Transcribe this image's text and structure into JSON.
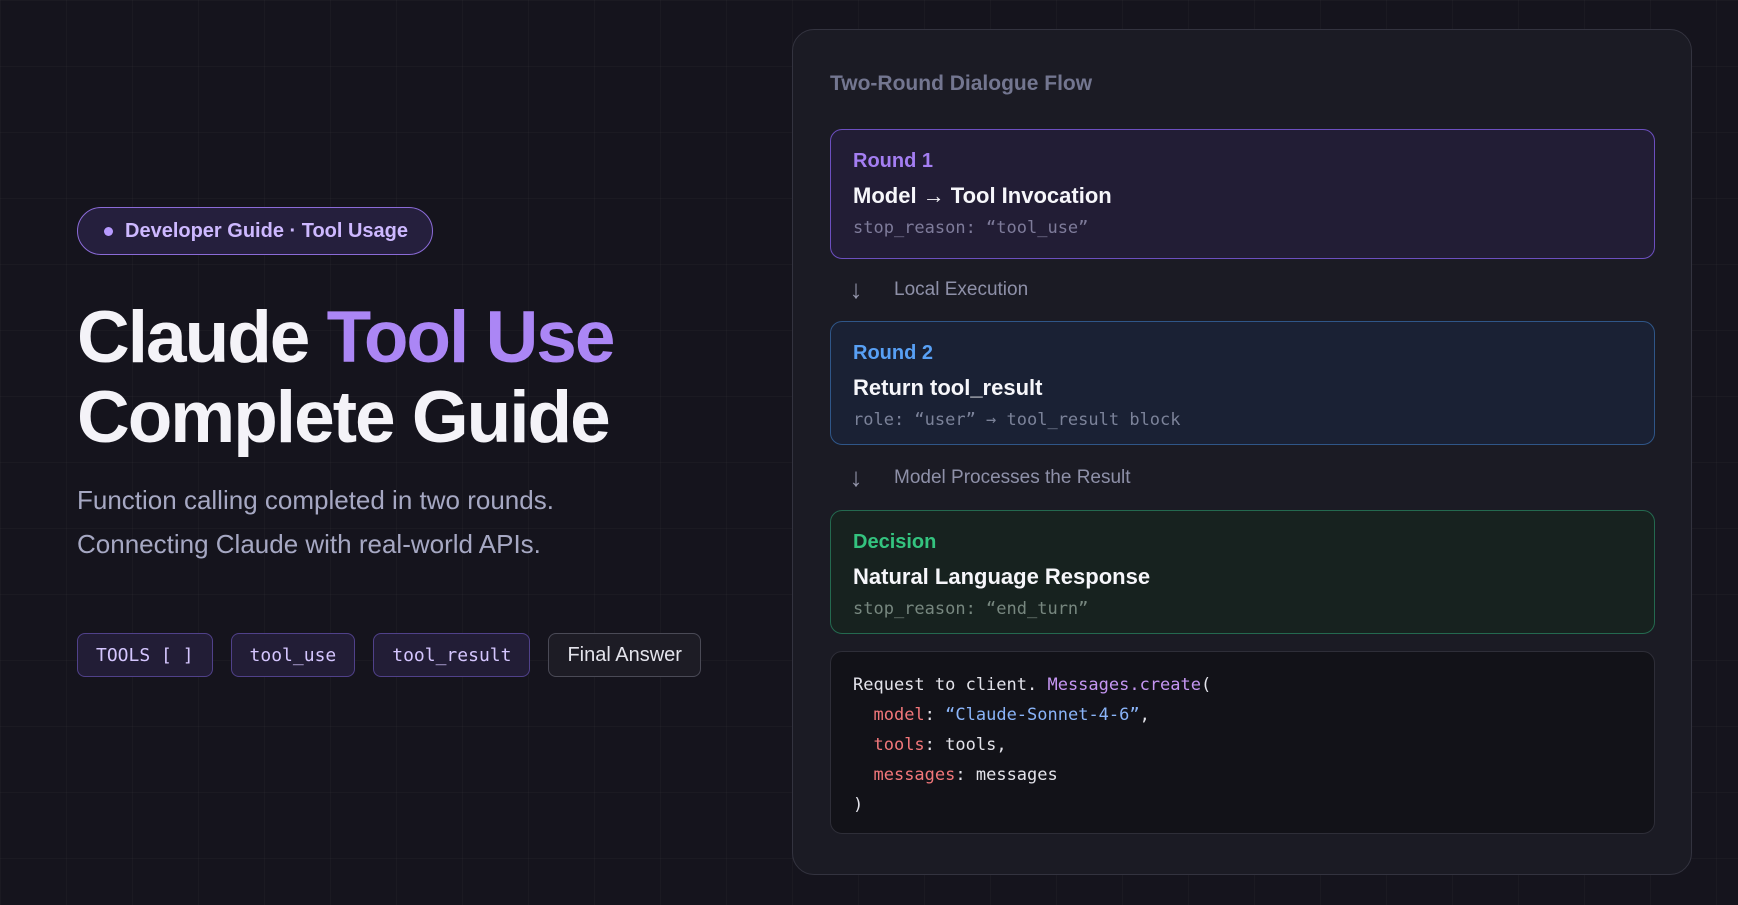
{
  "badge": {
    "text": "Developer Guide · Tool Usage"
  },
  "hero": {
    "title_plain": "Claude ",
    "title_accent": "Tool Use",
    "title_line2": "Complete Guide",
    "subtitle_line1": "Function calling completed in two rounds.",
    "subtitle_line2": "Connecting Claude with real-world APIs."
  },
  "chips": [
    "TOOLS [ ]",
    "tool_use",
    "tool_result",
    "Final Answer"
  ],
  "panel": {
    "title": "Two-Round Dialogue Flow",
    "round1": {
      "label": "Round 1",
      "heading": "Model → Tool Invocation",
      "note": "stop_reason: “tool_use”"
    },
    "step1": "Local Execution",
    "round2": {
      "label": "Round 2",
      "heading": "Return tool_result",
      "note": "role: “user” → tool_result block"
    },
    "step2": "Model Processes the Result",
    "decision": {
      "label": "Decision",
      "heading": "Natural Language Response",
      "note": "stop_reason: “end_turn”"
    },
    "step_arrow": "↓",
    "code": {
      "prefix": "Request to client. ",
      "call": "Messages.create",
      "open": "(",
      "model_key": "model",
      "model_val": "“Claude-Sonnet-4-6”",
      "tools_key": "tools",
      "tools_val": "tools",
      "messages_key": "messages",
      "messages_val": "messages",
      "close": ")"
    }
  },
  "colors": {
    "background": "#15141d",
    "accent_purple": "#ab86f5",
    "round2_blue": "#58a0f5",
    "decision_green": "#34c37f"
  }
}
